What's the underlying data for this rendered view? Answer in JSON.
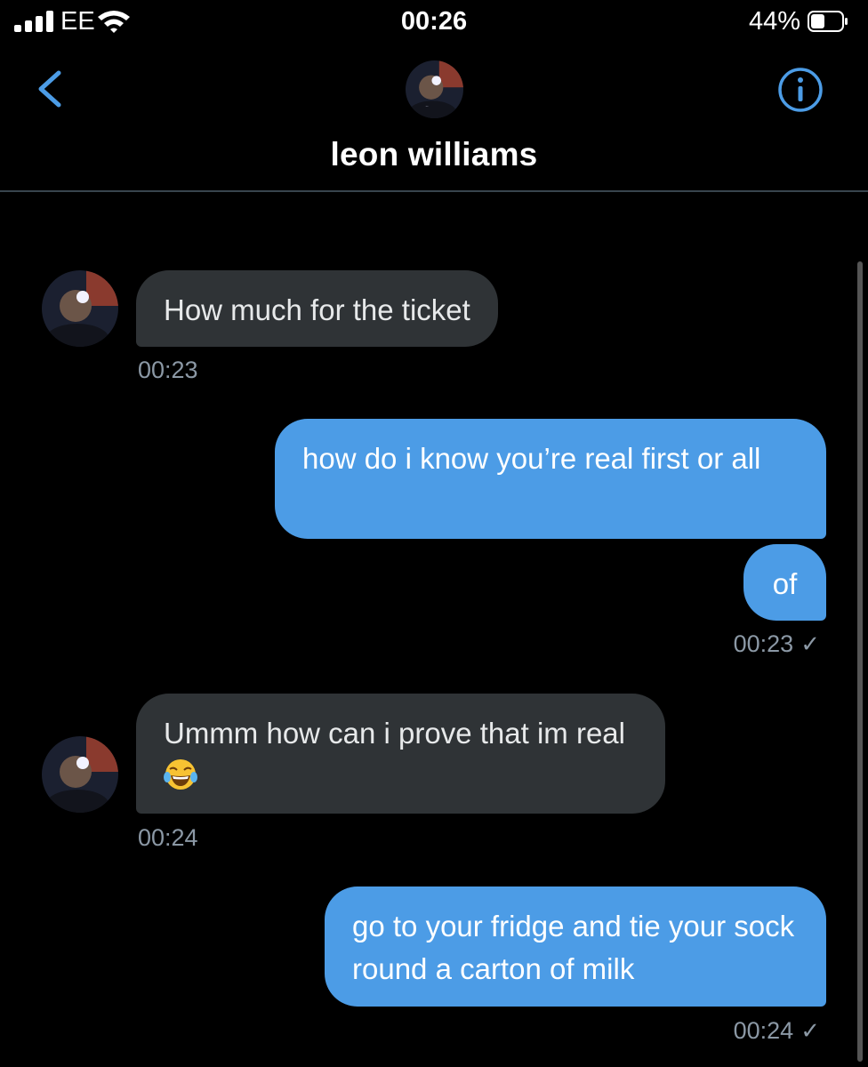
{
  "status_bar": {
    "carrier": "EE",
    "time": "00:26",
    "battery": "44%",
    "battery_level": 0.44
  },
  "header": {
    "title": "leon williams",
    "back_icon": "chevron-left-icon",
    "info_icon": "info-icon"
  },
  "colors": {
    "accent": "#4c9ce6",
    "received_bubble": "#2f3336",
    "timestamp": "#8b98a5"
  },
  "messages": [
    {
      "from": "them",
      "text": "How much for the ticket",
      "time": "00:23"
    },
    {
      "from": "me",
      "text": "how do i know you’re real first or all"
    },
    {
      "from": "me",
      "text": "of",
      "time": "00:23",
      "read_mark": "✓"
    },
    {
      "from": "them",
      "text": "Ummm how can i prove that im real",
      "emoji": "face-with-tears-of-joy",
      "time": "00:24"
    },
    {
      "from": "me",
      "text": "go to your fridge and tie your sock round a carton of milk",
      "time": "00:24",
      "read_mark": "✓"
    }
  ]
}
